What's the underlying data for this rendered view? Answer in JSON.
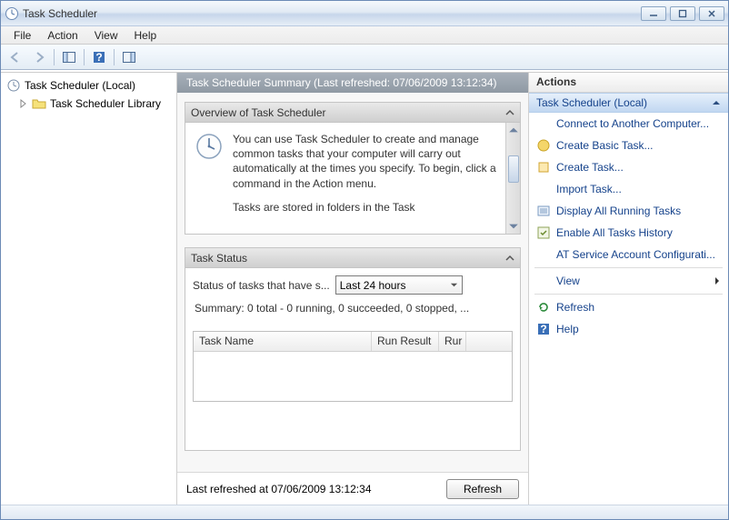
{
  "window": {
    "title": "Task Scheduler"
  },
  "menu": {
    "file": "File",
    "action": "Action",
    "view": "View",
    "help": "Help"
  },
  "tree": {
    "root": "Task Scheduler (Local)",
    "child": "Task Scheduler Library"
  },
  "summary": {
    "header": "Task Scheduler Summary (Last refreshed: 07/06/2009 13:12:34)",
    "overview_title": "Overview of Task Scheduler",
    "overview_body": "You can use Task Scheduler to create and manage common tasks that your computer will carry out automatically at the times you specify. To begin, click a command in the Action menu.",
    "overview_more": "Tasks are stored in folders in the Task",
    "task_status_title": "Task Status",
    "status_label": "Status of tasks that have s...",
    "status_dropdown": "Last 24 hours",
    "summary_line": "Summary: 0 total - 0 running, 0 succeeded, 0 stopped, ...",
    "cols": {
      "name": "Task Name",
      "result": "Run Result",
      "run": "Rur"
    },
    "last_refreshed": "Last refreshed at 07/06/2009 13:12:34",
    "refresh_btn": "Refresh"
  },
  "actions": {
    "title": "Actions",
    "section": "Task Scheduler (Local)",
    "items": {
      "connect": "Connect to Another Computer...",
      "create_basic": "Create Basic Task...",
      "create": "Create Task...",
      "import": "Import Task...",
      "display_running": "Display All Running Tasks",
      "enable_history": "Enable All Tasks History",
      "at_service": "AT Service Account Configurati...",
      "view": "View",
      "refresh": "Refresh",
      "help": "Help"
    }
  }
}
